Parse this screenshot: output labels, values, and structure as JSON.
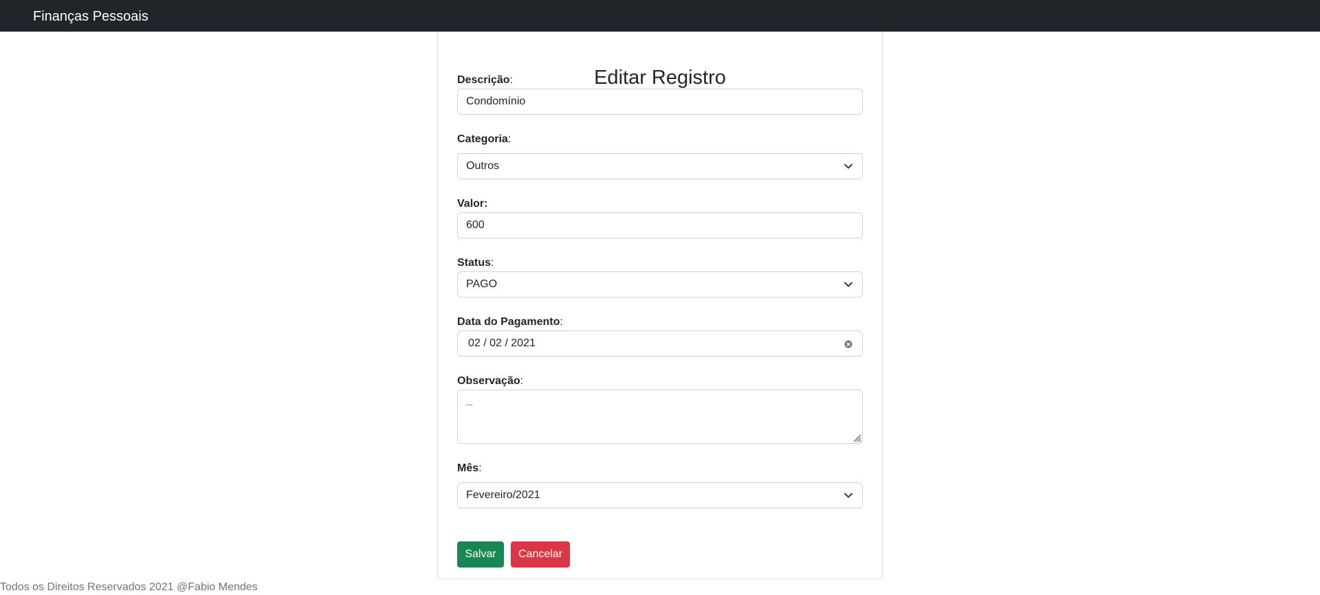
{
  "navbar": {
    "brand": "Finanças Pessoais"
  },
  "form": {
    "title": "Editar Registro",
    "descricao": {
      "label": "Descrição",
      "value": "Condomínio"
    },
    "categoria": {
      "label": "Categoria",
      "value": "Outros"
    },
    "valor": {
      "label": "Valor:",
      "value": "600"
    },
    "status": {
      "label": "Status",
      "value": "PAGO"
    },
    "data_pagamento": {
      "label": "Data do Pagamento",
      "value": "02 / 02 / 2021"
    },
    "observacao": {
      "label": "Observação",
      "value": "..."
    },
    "mes": {
      "label": "Mês",
      "value": "Fevereiro/2021"
    },
    "colon": ":",
    "save_label": "Salvar",
    "cancel_label": "Cancelar"
  },
  "footer": {
    "text": "Todos os Direitos Reservados 2021 @Fabio Mendes"
  },
  "icons": {
    "select": "chevron-down-icon",
    "date_clear": "clear-icon",
    "textarea": "resize-grip-icon"
  },
  "colors": {
    "navbar": "#212529",
    "save": "#198754",
    "cancel": "#dc3545",
    "footer_text": "#6c757d"
  }
}
